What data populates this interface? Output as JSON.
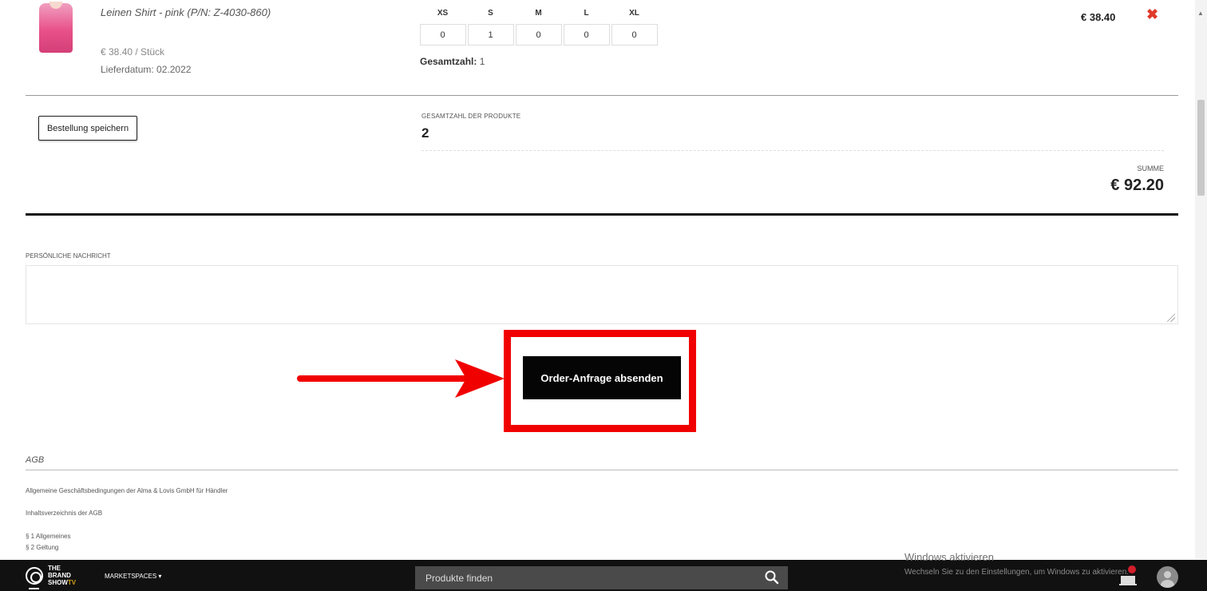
{
  "product": {
    "title": "Leinen Shirt - pink (P/N: Z-4030-860)",
    "unit_price": "€ 38.40 / Stück",
    "delivery_date": "Lieferdatum: 02.2022",
    "line_price": "€ 38.40",
    "remove_icon": "close-icon",
    "sizes": [
      {
        "label": "XS",
        "qty": "0"
      },
      {
        "label": "S",
        "qty": "1"
      },
      {
        "label": "M",
        "qty": "0"
      },
      {
        "label": "L",
        "qty": "0"
      },
      {
        "label": "XL",
        "qty": "0"
      }
    ],
    "total_label": "Gesamtzahl:",
    "total_value": "1"
  },
  "summary": {
    "save_label": "Bestellung speichern",
    "count_label": "GESAMTZAHL DER PRODUKTE",
    "count_value": "2",
    "sum_label": "SUMME",
    "sum_value": "€ 92.20"
  },
  "message": {
    "label": "PERSÖNLICHE NACHRICHT",
    "value": ""
  },
  "submit": {
    "label": "Order-Anfrage absenden",
    "highlight_color": "#f10000"
  },
  "agb": {
    "title": "AGB",
    "lines": [
      "Allgemeine Geschäftsbedingungen der Alma & Lovis GmbH für Händler",
      "Inhaltsverzeichnis der AGB",
      "§ 1 Allgemeines",
      "§ 2 Geltung"
    ]
  },
  "bottombar": {
    "brand": [
      "THE",
      "BRAND",
      "SHOW"
    ],
    "brand_tv": "TV",
    "marketspaces": "MARKETSPACES ▾",
    "search_placeholder": "Produkte finden",
    "windows_title": "Windows aktivieren",
    "windows_text": "Wechseln Sie zu den Einstellungen, um Windows zu aktivieren."
  }
}
